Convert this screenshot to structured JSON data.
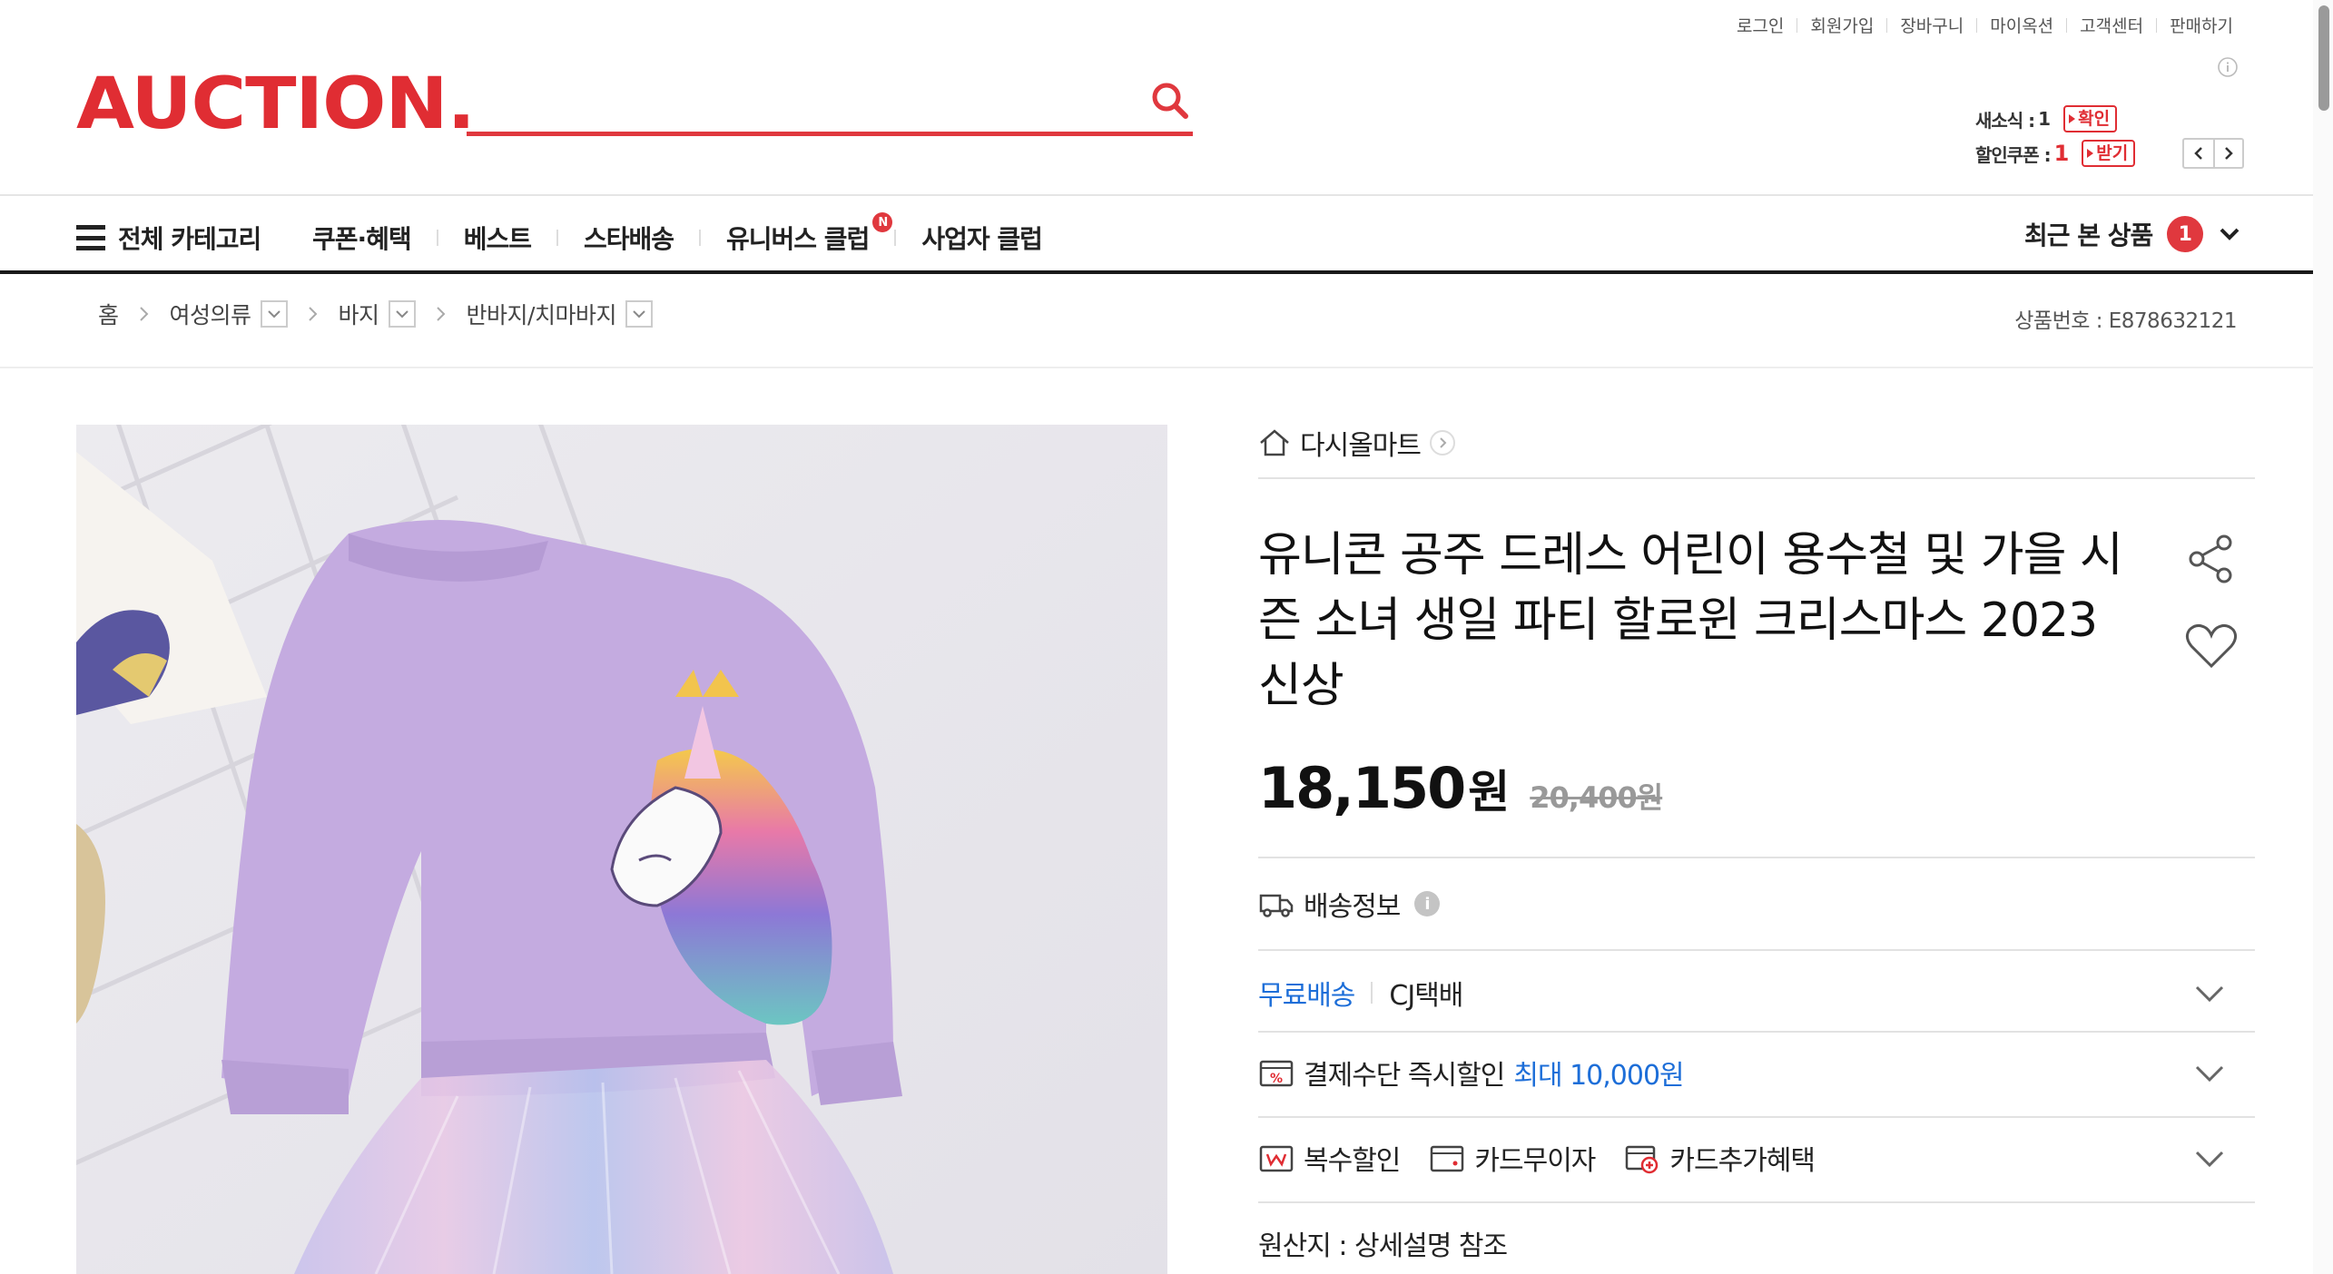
{
  "util_links": [
    "로그인",
    "회원가입",
    "장바구니",
    "마이옥션",
    "고객센터",
    "판매하기"
  ],
  "header": {
    "logo": "AUCTION.",
    "search_placeholder": "",
    "news_label": "새소식 :",
    "news_count": "1",
    "news_action": "확인",
    "coupon_label": "할인쿠폰 :",
    "coupon_count": "1",
    "coupon_action": "받기"
  },
  "nav": {
    "all_categories": "전체 카테고리",
    "items": [
      "쿠폰·혜택",
      "베스트",
      "스타배송",
      "유니버스 클럽",
      "사업자 클럽"
    ],
    "new_badge": "N",
    "recent_label": "최근 본 상품",
    "recent_count": "1"
  },
  "breadcrumb": {
    "home": "홈",
    "levels": [
      "여성의류",
      "바지",
      "반바지/치마바지"
    ],
    "product_no": "상품번호 : E878632121"
  },
  "product": {
    "seller": "다시올마트",
    "title": "유니콘 공주 드레스 어린이 용수철 및 가을 시즌 소녀 생일 파티 할로윈 크리스마스 2023 신상",
    "price": "18,150",
    "price_unit": "원",
    "original_price": "20,400원"
  },
  "info": {
    "shipping_info": "배송정보",
    "free_shipping": "무료배송",
    "courier": "CJ택배",
    "payment_discount": "결제수단 즉시할인",
    "payment_discount_max": "최대 10,000원",
    "multi_discount": "복수할인",
    "card_interest_free": "카드무이자",
    "card_extra_benefit": "카드추가혜택",
    "origin": "원산지 : 상세설명 참조"
  },
  "colors": {
    "brand_red": "#e02d33",
    "accent_blue": "#1d6ed8"
  }
}
